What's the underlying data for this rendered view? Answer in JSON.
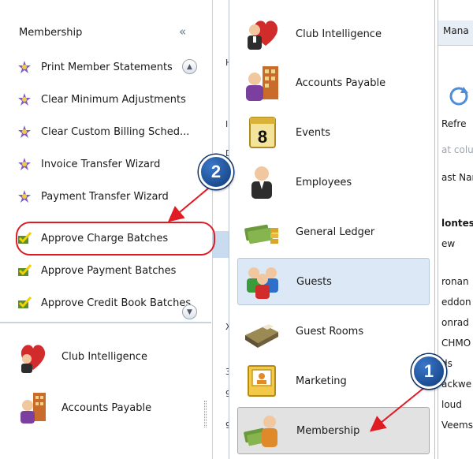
{
  "left_panel": {
    "title": "Membership",
    "collapse_glyph": "«",
    "tasks": [
      {
        "label": "Print Member Statements",
        "icon": "wizard-icon"
      },
      {
        "label": "Clear Minimum Adjustments",
        "icon": "wizard-icon"
      },
      {
        "label": "Clear Custom Billing Sched...",
        "icon": "wizard-icon"
      },
      {
        "label": "Invoice Transfer Wizard",
        "icon": "wizard-icon"
      },
      {
        "label": "Payment Transfer Wizard",
        "icon": "wizard-icon"
      },
      {
        "label": "Approve Charge Batches",
        "icon": "approve-icon"
      },
      {
        "label": "Approve Payment Batches",
        "icon": "approve-icon"
      },
      {
        "label": "Approve Credit Book Batches",
        "icon": "approve-icon"
      }
    ],
    "modules": [
      {
        "label": "Club Intelligence",
        "icon": "heart-person-icon"
      },
      {
        "label": "Accounts Payable",
        "icon": "building-person-icon"
      }
    ]
  },
  "nav_menu": {
    "items": [
      {
        "label": "Club Intelligence",
        "icon": "heart-person-icon",
        "state": "normal"
      },
      {
        "label": "Accounts Payable",
        "icon": "building-person-icon",
        "state": "normal"
      },
      {
        "label": "Events",
        "icon": "calendar-icon",
        "state": "normal"
      },
      {
        "label": "Employees",
        "icon": "employee-icon",
        "state": "normal"
      },
      {
        "label": "General Ledger",
        "icon": "money-icon",
        "state": "normal"
      },
      {
        "label": "Guests",
        "icon": "group-icon",
        "state": "selected"
      },
      {
        "label": "Guest Rooms",
        "icon": "bed-icon",
        "state": "normal"
      },
      {
        "label": "Marketing",
        "icon": "marketing-icon",
        "state": "normal"
      },
      {
        "label": "Membership",
        "icon": "money-person-icon",
        "state": "hovered"
      }
    ]
  },
  "background": {
    "strip_chars": [
      "H",
      "I",
      "Dr",
      "X",
      "3",
      "9",
      "9"
    ],
    "right_fragments": [
      "Mana",
      "Refre",
      "at colu",
      "ast Nan",
      "lontes",
      "ew",
      "ronan",
      "eddon",
      "onrad",
      "CHMO",
      "ds",
      "ackwe",
      "loud",
      "Veems"
    ]
  },
  "annotations": {
    "badge_1": "1",
    "badge_2": "2"
  },
  "colors": {
    "annotation_red": "#e01b24",
    "badge_blue": "#1f56a6",
    "selected_bg": "#dce8f5",
    "hover_bg": "#e2e2e2"
  }
}
